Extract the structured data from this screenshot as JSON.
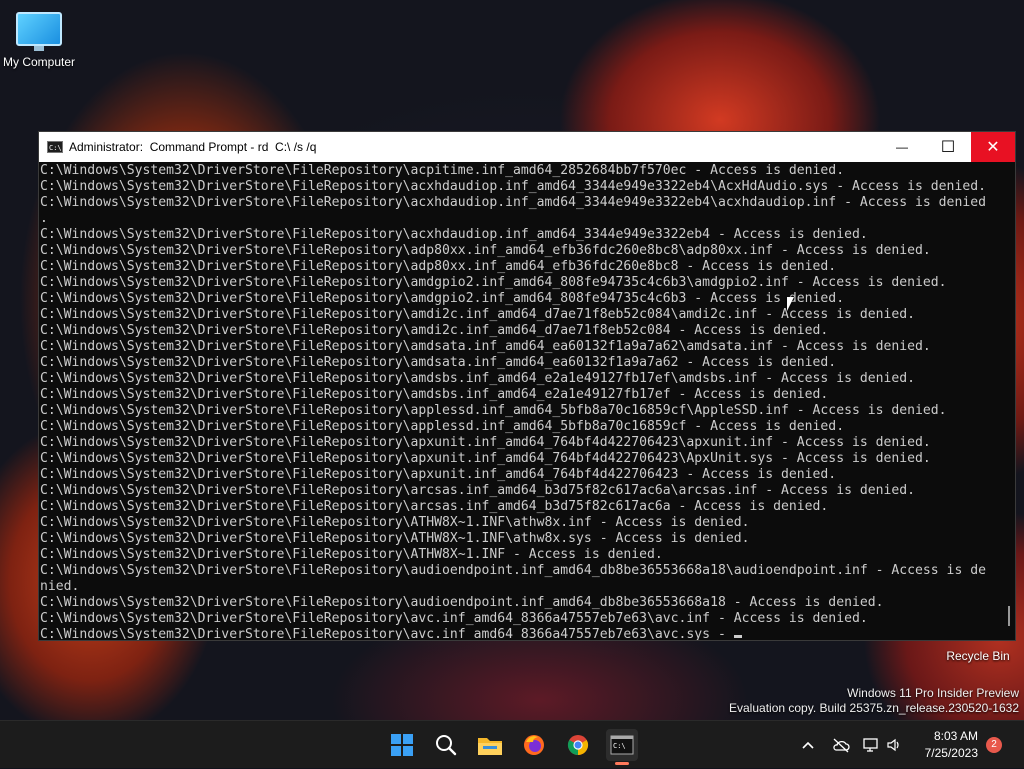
{
  "desktop": {
    "my_computer_label": "My Computer",
    "recycle_bin_label": "Recycle Bin",
    "watermark_line1": "Windows 11 Pro Insider Preview",
    "watermark_line2": "Evaluation copy. Build 25375.zn_release.230520-1632"
  },
  "window": {
    "icon_text": "C:\\",
    "title": "Administrator:  Command Prompt - rd  C:\\ /s /q",
    "minimize": "—",
    "maximize": "☐",
    "close": "✕"
  },
  "console": {
    "lines": [
      "C:\\Windows\\System32\\DriverStore\\FileRepository\\acpitime.inf_amd64_2852684bb7f570ec - Access is denied.",
      "C:\\Windows\\System32\\DriverStore\\FileRepository\\acxhdaudiop.inf_amd64_3344e949e3322eb4\\AcxHdAudio.sys - Access is denied.",
      "C:\\Windows\\System32\\DriverStore\\FileRepository\\acxhdaudiop.inf_amd64_3344e949e3322eb4\\acxhdaudiop.inf - Access is denied",
      ".",
      "C:\\Windows\\System32\\DriverStore\\FileRepository\\acxhdaudiop.inf_amd64_3344e949e3322eb4 - Access is denied.",
      "C:\\Windows\\System32\\DriverStore\\FileRepository\\adp80xx.inf_amd64_efb36fdc260e8bc8\\adp80xx.inf - Access is denied.",
      "C:\\Windows\\System32\\DriverStore\\FileRepository\\adp80xx.inf_amd64_efb36fdc260e8bc8 - Access is denied.",
      "C:\\Windows\\System32\\DriverStore\\FileRepository\\amdgpio2.inf_amd64_808fe94735c4c6b3\\amdgpio2.inf - Access is denied.",
      "C:\\Windows\\System32\\DriverStore\\FileRepository\\amdgpio2.inf_amd64_808fe94735c4c6b3 - Access is denied.",
      "C:\\Windows\\System32\\DriverStore\\FileRepository\\amdi2c.inf_amd64_d7ae71f8eb52c084\\amdi2c.inf - Access is denied.",
      "C:\\Windows\\System32\\DriverStore\\FileRepository\\amdi2c.inf_amd64_d7ae71f8eb52c084 - Access is denied.",
      "C:\\Windows\\System32\\DriverStore\\FileRepository\\amdsata.inf_amd64_ea60132f1a9a7a62\\amdsata.inf - Access is denied.",
      "C:\\Windows\\System32\\DriverStore\\FileRepository\\amdsata.inf_amd64_ea60132f1a9a7a62 - Access is denied.",
      "C:\\Windows\\System32\\DriverStore\\FileRepository\\amdsbs.inf_amd64_e2a1e49127fb17ef\\amdsbs.inf - Access is denied.",
      "C:\\Windows\\System32\\DriverStore\\FileRepository\\amdsbs.inf_amd64_e2a1e49127fb17ef - Access is denied.",
      "C:\\Windows\\System32\\DriverStore\\FileRepository\\applessd.inf_amd64_5bfb8a70c16859cf\\AppleSSD.inf - Access is denied.",
      "C:\\Windows\\System32\\DriverStore\\FileRepository\\applessd.inf_amd64_5bfb8a70c16859cf - Access is denied.",
      "C:\\Windows\\System32\\DriverStore\\FileRepository\\apxunit.inf_amd64_764bf4d422706423\\apxunit.inf - Access is denied.",
      "C:\\Windows\\System32\\DriverStore\\FileRepository\\apxunit.inf_amd64_764bf4d422706423\\ApxUnit.sys - Access is denied.",
      "C:\\Windows\\System32\\DriverStore\\FileRepository\\apxunit.inf_amd64_764bf4d422706423 - Access is denied.",
      "C:\\Windows\\System32\\DriverStore\\FileRepository\\arcsas.inf_amd64_b3d75f82c617ac6a\\arcsas.inf - Access is denied.",
      "C:\\Windows\\System32\\DriverStore\\FileRepository\\arcsas.inf_amd64_b3d75f82c617ac6a - Access is denied.",
      "C:\\Windows\\System32\\DriverStore\\FileRepository\\ATHW8X~1.INF\\athw8x.inf - Access is denied.",
      "C:\\Windows\\System32\\DriverStore\\FileRepository\\ATHW8X~1.INF\\athw8x.sys - Access is denied.",
      "C:\\Windows\\System32\\DriverStore\\FileRepository\\ATHW8X~1.INF - Access is denied.",
      "C:\\Windows\\System32\\DriverStore\\FileRepository\\audioendpoint.inf_amd64_db8be36553668a18\\audioendpoint.inf - Access is de",
      "nied.",
      "C:\\Windows\\System32\\DriverStore\\FileRepository\\audioendpoint.inf_amd64_db8be36553668a18 - Access is denied.",
      "C:\\Windows\\System32\\DriverStore\\FileRepository\\avc.inf_amd64_8366a47557eb7e63\\avc.inf - Access is denied.",
      "C:\\Windows\\System32\\DriverStore\\FileRepository\\avc.inf_amd64_8366a47557eb7e63\\avc.sys - "
    ]
  },
  "taskbar": {
    "time": "8:03 AM",
    "date": "7/25/2023",
    "notification_count": "2",
    "apps": [
      {
        "name": "start-button",
        "icon": "windows-logo"
      },
      {
        "name": "search-button",
        "icon": "search-icon"
      },
      {
        "name": "file-explorer-button",
        "icon": "folder-icon"
      },
      {
        "name": "firefox-button",
        "icon": "firefox-icon"
      },
      {
        "name": "chrome-button",
        "icon": "chrome-icon"
      },
      {
        "name": "terminal-button",
        "icon": "terminal-icon"
      }
    ],
    "colors": {
      "accent": "#3aa0f5",
      "close_red": "#e81123",
      "badge": "#e8594c"
    }
  }
}
